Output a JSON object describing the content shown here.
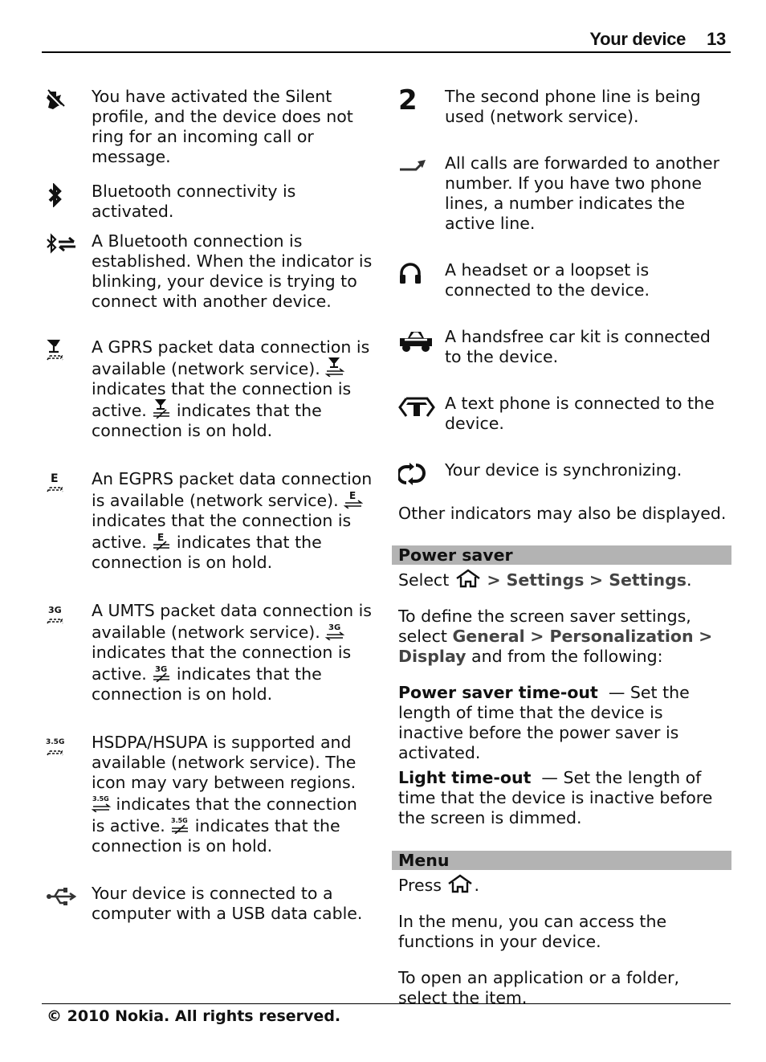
{
  "header": {
    "section_title": "Your device",
    "page_number": "13"
  },
  "left_column": {
    "entries": [
      {
        "icon": "silent-profile-icon",
        "text": "You have activated the Silent profile, and the device does not ring for an incoming call or message."
      },
      {
        "icon": "bluetooth-icon",
        "text": "Bluetooth connectivity is activated."
      },
      {
        "icon": "bluetooth-connection-icon",
        "text": "A Bluetooth connection is established. When the indicator is blinking, your device is trying to connect with another device."
      },
      {
        "icon": "gprs-icon",
        "label": "GPRS",
        "text_a": "A GPRS packet data connection is available (network service).",
        "text_b": "indicates that the connection is active.",
        "text_c": "indicates that the connection is on hold."
      },
      {
        "icon": "egprs-icon",
        "label": "E",
        "text_a": "An EGPRS packet data connection is available (network service).",
        "text_b": "indicates that the connection is active.",
        "text_c": "indicates that the connection is on hold."
      },
      {
        "icon": "umts-icon",
        "label": "3G",
        "text_a": "A UMTS packet data connection is available (network service).",
        "text_b": "indicates that the connection is active.",
        "text_c": "indicates that the connection is on hold."
      },
      {
        "icon": "hsdpa-icon",
        "label": "3.5G",
        "text_a": "HSDPA/HSUPA is supported and available (network service). The icon may vary between regions.",
        "text_b": "indicates that the connection is active.",
        "text_c": "indicates that the connection is on hold."
      },
      {
        "icon": "usb-icon",
        "text": "Your device is connected to a computer with a USB data cable."
      }
    ]
  },
  "right_column": {
    "entries": [
      {
        "icon": "second-line-icon",
        "glyph": "2",
        "text": "The second phone line is being used (network service)."
      },
      {
        "icon": "call-forward-icon",
        "text": "All calls are forwarded to another number. If you have two phone lines, a number indicates the active line."
      },
      {
        "icon": "headset-icon",
        "text": "A headset or a loopset is connected to the device."
      },
      {
        "icon": "car-kit-icon",
        "text": "A handsfree car kit is connected to the device."
      },
      {
        "icon": "text-phone-icon",
        "text": "A text phone is connected to the device."
      },
      {
        "icon": "sync-icon",
        "text": "Your device is synchronizing."
      }
    ],
    "other_indicators": "Other indicators may also be displayed.",
    "power_saver": {
      "heading": "Power saver",
      "select_prefix": "Select",
      "path": [
        "> Settings",
        "> Settings"
      ],
      "path_suffix": ".",
      "intro": "To define the screen saver settings, select",
      "intro_path": [
        "General",
        "> Personalization",
        "> Display"
      ],
      "intro_suffix": "and from the following:",
      "options": [
        {
          "term": "Power saver time-out",
          "desc": "— Set the length of time that the device is inactive before the power saver is activated."
        },
        {
          "term": "Light time-out",
          "desc": "— Set the length of time that the device is inactive before the screen is dimmed."
        }
      ]
    },
    "menu": {
      "heading": "Menu",
      "press_prefix": "Press",
      "press_suffix": ".",
      "para1": "In the menu, you can access the functions in your device.",
      "para2": "To open an application or a folder, select the item."
    }
  },
  "footer": {
    "copyright": "© 2010 Nokia. All rights reserved."
  },
  "colors": {
    "section_bar": "#b3b3b3",
    "menu_path": "#444444",
    "text": "#111111"
  }
}
